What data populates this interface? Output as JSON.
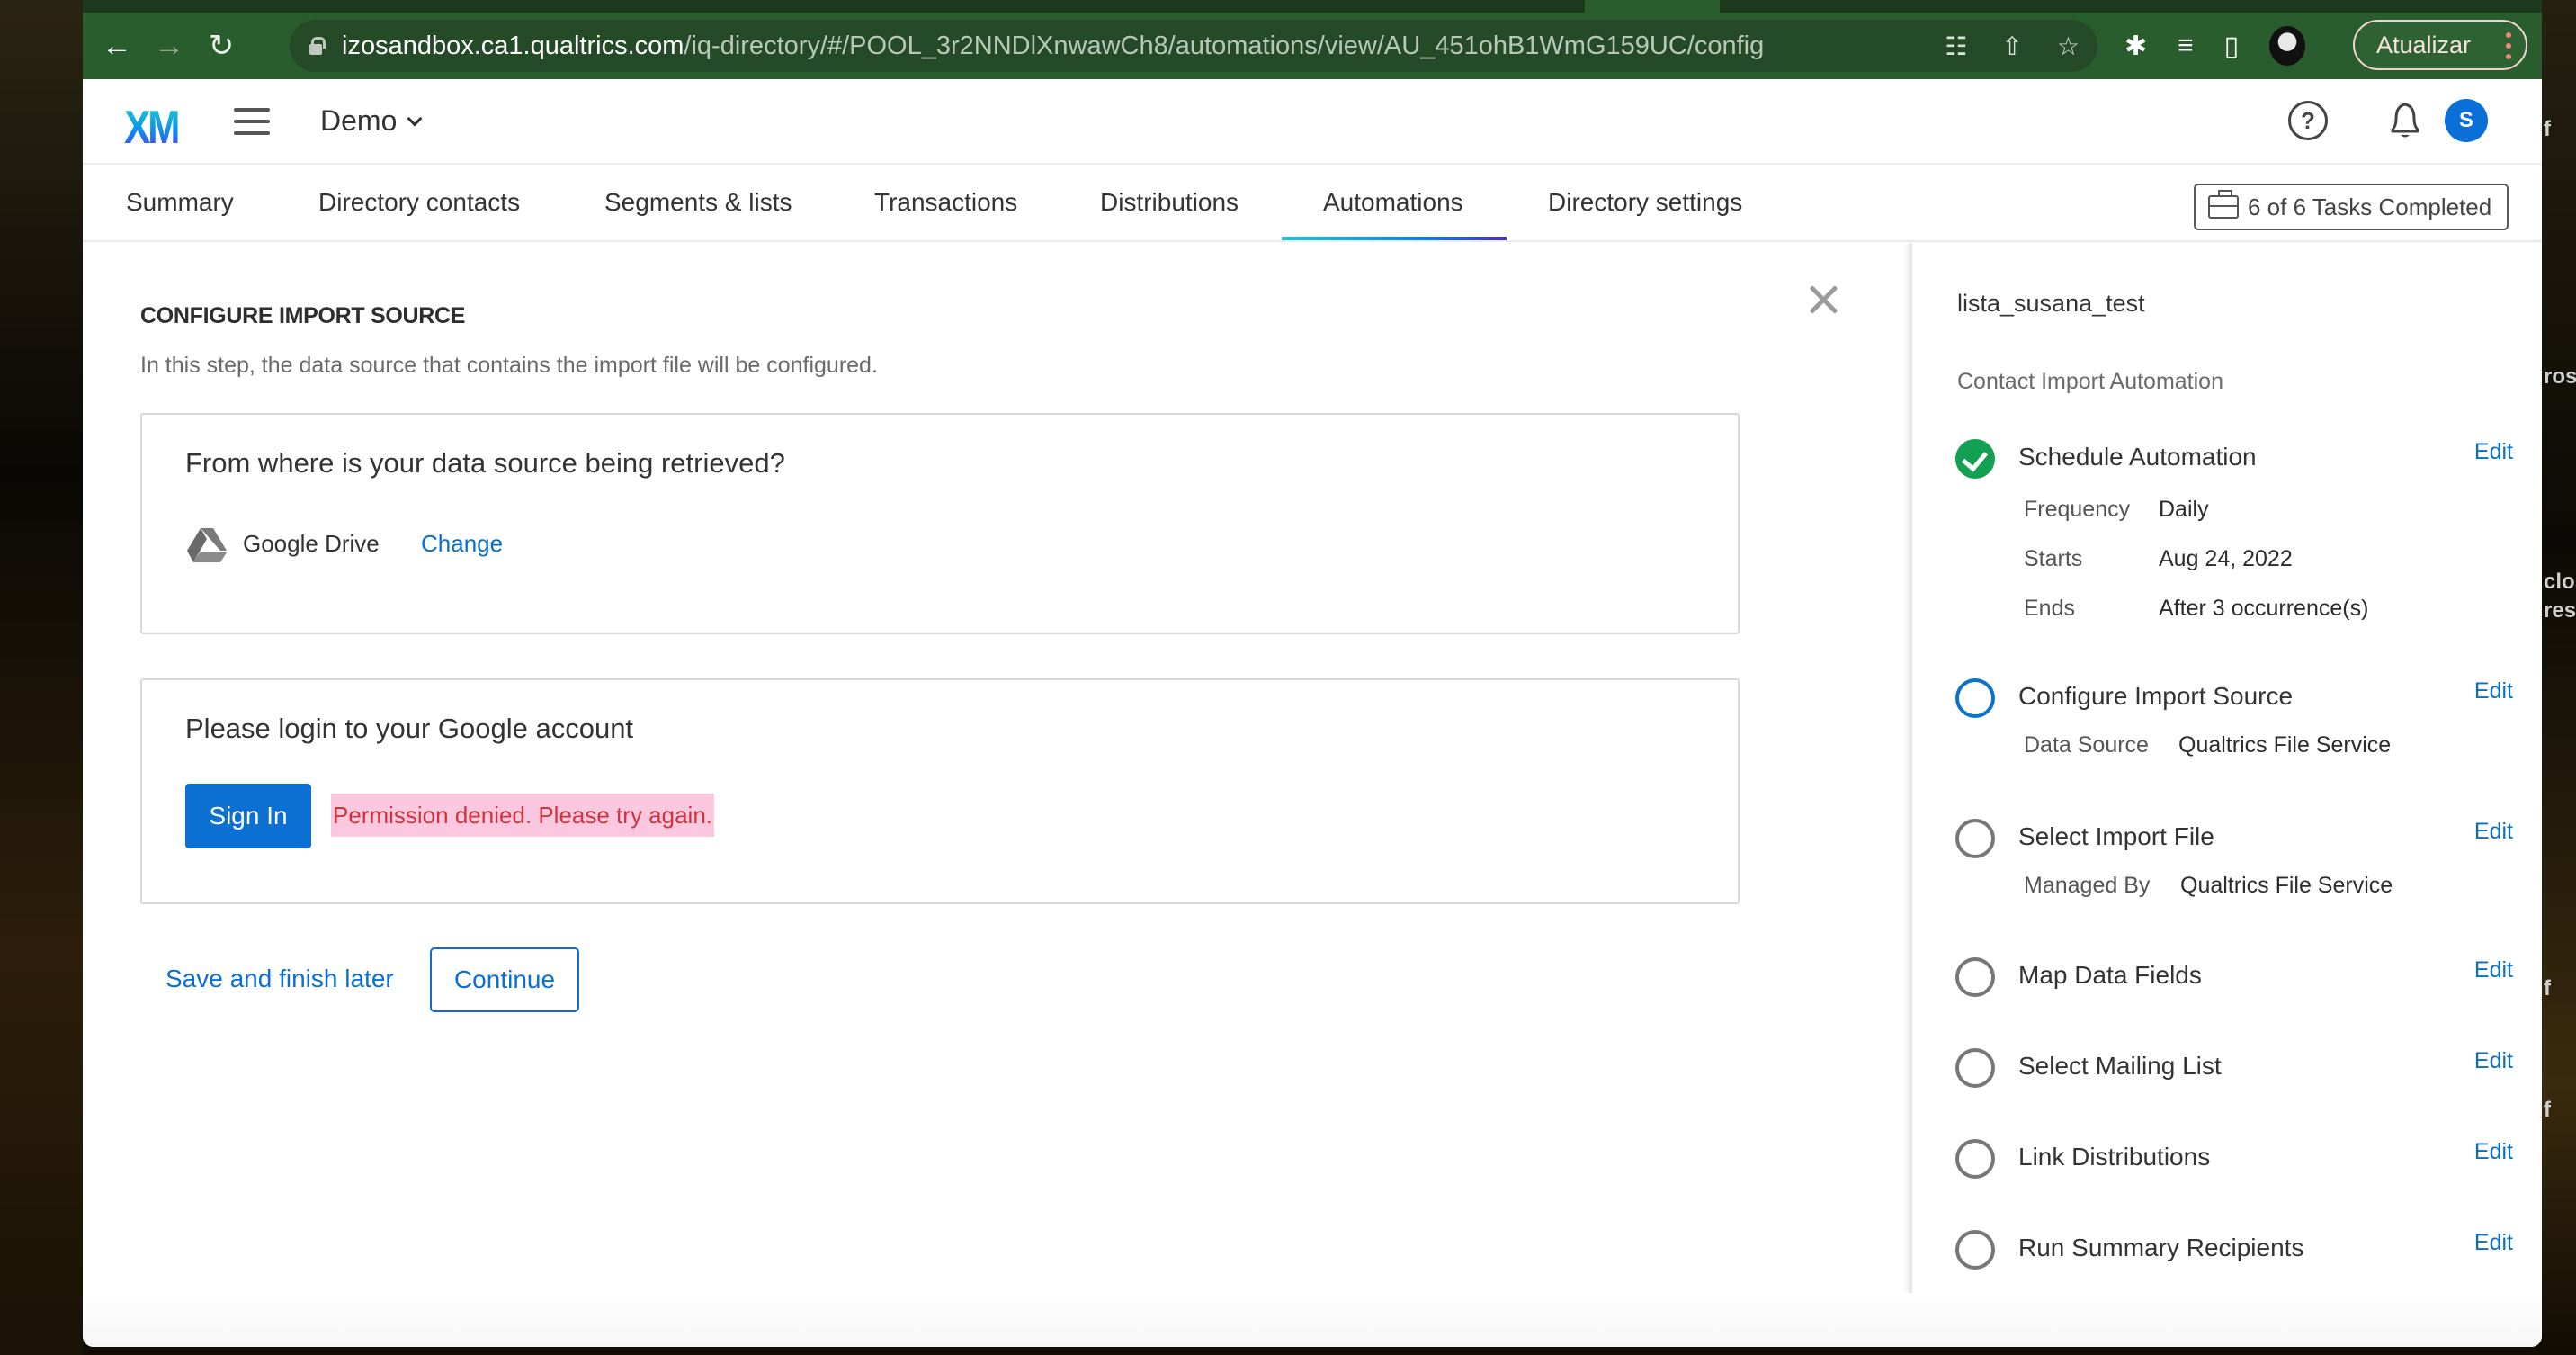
{
  "browser": {
    "url_host": "izosandbox.ca1.qualtrics.com",
    "url_path": "/iq-directory/#/POOL_3r2NNDlXnwawCh8/automations/view/AU_451ohB1WmG159UC/config",
    "update_label": "Atualizar",
    "icons": [
      "back-icon",
      "forward-icon",
      "reload-icon",
      "lock-icon",
      "translate-icon",
      "share-icon",
      "star-icon",
      "extensions-icon",
      "reading-list-icon",
      "side-panel-icon",
      "profile-icon",
      "more-icon"
    ]
  },
  "header": {
    "logo": "XM",
    "project": "Demo",
    "avatar_initial": "S"
  },
  "tabs": [
    {
      "label": "Summary",
      "active": false
    },
    {
      "label": "Directory contacts",
      "active": false
    },
    {
      "label": "Segments & lists",
      "active": false
    },
    {
      "label": "Transactions",
      "active": false
    },
    {
      "label": "Distributions",
      "active": false
    },
    {
      "label": "Automations",
      "active": true
    },
    {
      "label": "Directory settings",
      "active": false
    }
  ],
  "tasks_button": "6 of 6 Tasks Completed",
  "main": {
    "title": "CONFIGURE IMPORT SOURCE",
    "description": "In this step, the data source that contains the import file will be configured.",
    "source_card": {
      "question": "From where is your data source being retrieved?",
      "source": "Google Drive",
      "change_label": "Change"
    },
    "login_card": {
      "question": "Please login to your Google account",
      "signin_label": "Sign In",
      "error": "Permission denied. Please try again."
    },
    "save_later_label": "Save and finish later",
    "continue_label": "Continue"
  },
  "side": {
    "title": "lista_susana_test",
    "subtitle": "Contact Import Automation",
    "edit_label": "Edit",
    "steps": [
      {
        "label": "Schedule Automation",
        "status": "done",
        "details": [
          {
            "key": "Frequency",
            "value": "Daily"
          },
          {
            "key": "Starts",
            "value": "Aug 24, 2022"
          },
          {
            "key": "Ends",
            "value": "After 3 occurrence(s)"
          }
        ]
      },
      {
        "label": "Configure Import Source",
        "status": "current",
        "details": [
          {
            "key": "Data Source",
            "value": "Qualtrics File Service"
          }
        ]
      },
      {
        "label": "Select Import File",
        "status": "pending",
        "details": [
          {
            "key": "Managed By",
            "value": "Qualtrics File Service"
          }
        ]
      },
      {
        "label": "Map Data Fields",
        "status": "pending",
        "details": []
      },
      {
        "label": "Select Mailing List",
        "status": "pending",
        "details": []
      },
      {
        "label": "Link Distributions",
        "status": "pending",
        "details": []
      },
      {
        "label": "Run Summary Recipients",
        "status": "pending",
        "details": []
      }
    ]
  },
  "background_text": [
    "f",
    "ros",
    "clos",
    "res.",
    "f",
    "f"
  ],
  "colors": {
    "chrome_green": "#295d2e",
    "primary_blue": "#0c6fd2",
    "link_blue": "#0c6fc4",
    "success_green": "#12a152",
    "error_red": "#d0343e",
    "error_bg": "#fbc8e0"
  }
}
